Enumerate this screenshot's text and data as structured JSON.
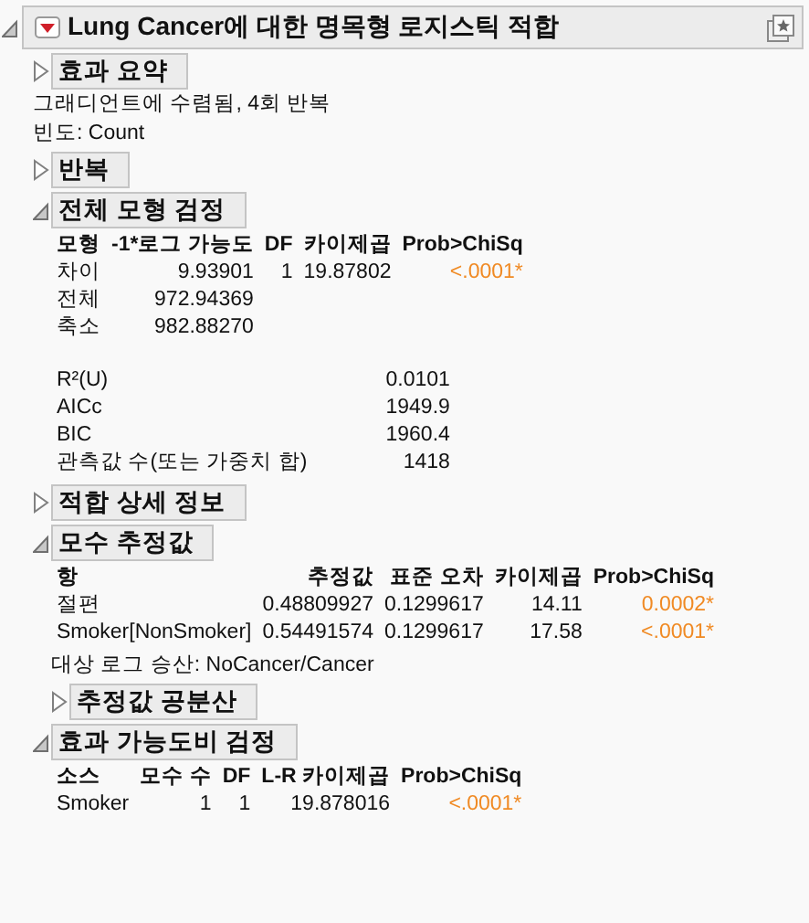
{
  "report": {
    "title": "Lung Cancer에 대한 명목형 로지스틱 적합",
    "expanded": true,
    "content": [
      {
        "kind": "section",
        "title": "효과 요약",
        "expanded": false
      },
      {
        "kind": "note",
        "text": "그래디언트에 수렴됨, 4회 반복"
      },
      {
        "kind": "note",
        "text": "빈도: Count"
      },
      {
        "kind": "section",
        "title": "반복",
        "expanded": false
      },
      {
        "kind": "section",
        "title": "전체 모형 검정",
        "expanded": true,
        "content": [
          {
            "kind": "table",
            "columns": [
              "모형",
              "-1*로그 가능도",
              "DF",
              "카이제곱",
              "Prob>ChiSq"
            ],
            "rows": [
              {
                "cells": [
                  "차이",
                  "9.93901",
                  "1",
                  "19.87802",
                  "<.0001*"
                ],
                "significant": true
              },
              {
                "cells": [
                  "전체",
                  "972.94369"
                ]
              },
              {
                "cells": [
                  "축소",
                  "982.88270"
                ]
              }
            ]
          },
          {
            "kind": "table",
            "rows": [
              {
                "cells": [
                  "R²(U)",
                  "0.0101"
                ]
              },
              {
                "cells": [
                  "AICc",
                  "1949.9"
                ]
              },
              {
                "cells": [
                  "BIC",
                  "1960.4"
                ]
              },
              {
                "cells": [
                  "관측값 수(또는 가중치 합)",
                  "1418"
                ]
              }
            ]
          }
        ]
      },
      {
        "kind": "section",
        "title": "적합 상세 정보",
        "expanded": false
      },
      {
        "kind": "section",
        "title": "모수 추정값",
        "expanded": true,
        "content": [
          {
            "kind": "table",
            "columns": [
              "항",
              "추정값",
              "표준 오차",
              "카이제곱",
              "Prob>ChiSq"
            ],
            "rows": [
              {
                "cells": [
                  "절편",
                  "0.48809927",
                  "0.1299617",
                  "14.11",
                  "0.0002*"
                ],
                "significant": true
              },
              {
                "cells": [
                  "Smoker[NonSmoker]",
                  "0.54491574",
                  "0.1299617",
                  "17.58",
                  "<.0001*"
                ],
                "significant": true
              }
            ]
          },
          {
            "kind": "note",
            "text": "대상 로그 승산: NoCancer/Cancer"
          },
          {
            "kind": "section",
            "title": "추정값 공분산",
            "expanded": false
          }
        ]
      },
      {
        "kind": "section",
        "title": "효과 가능도비 검정",
        "expanded": true,
        "content": [
          {
            "kind": "table",
            "columns": [
              "소스",
              "모수 수",
              "DF",
              "L-R 카이제곱",
              "Prob>ChiSq"
            ],
            "rows": [
              {
                "cells": [
                  "Smoker",
                  "1",
                  "1",
                  "19.878016",
                  "<.0001*"
                ],
                "significant": true
              }
            ]
          }
        ]
      }
    ]
  }
}
